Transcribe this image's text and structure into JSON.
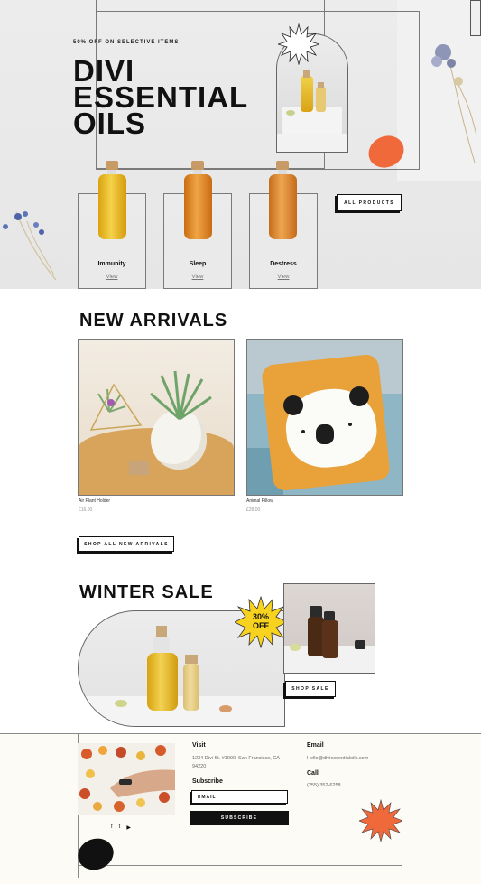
{
  "hero": {
    "eyebrow": "50% OFF ON SELECTIVE ITEMS",
    "title_line1": "DIVI",
    "title_line2": "ESSENTIAL",
    "title_line3": "OILS",
    "all_products_label": "ALL PRODUCTS",
    "accent": "#f0693a"
  },
  "products": [
    {
      "name": "Immunity",
      "link": "View",
      "liquid": "#e8b418"
    },
    {
      "name": "Sleep",
      "link": "View",
      "liquid": "#e0892a"
    },
    {
      "name": "Destress",
      "link": "View",
      "liquid": "#de8a30"
    }
  ],
  "new_arrivals": {
    "title": "NEW ARRIVALS",
    "items": [
      {
        "name": "Air Plant Holder",
        "price": "£16.00"
      },
      {
        "name": "Animal Pillow",
        "price": "£28.00"
      }
    ],
    "shop_all_label": "SHOP ALL NEW ARRIVALS"
  },
  "winter_sale": {
    "title": "WINTER SALE",
    "badge_line1": "30%",
    "badge_line2": "OFF",
    "shop_sale_label": "SHOP SALE",
    "badge_color": "#f7d21e"
  },
  "footer": {
    "visit_heading": "Visit",
    "address_line1": "1234 Divi St. #1000, San Francisco, CA",
    "address_line2": "94220",
    "email_heading": "Email",
    "email_value": "Hello@diviessentialoils.com",
    "call_heading": "Call",
    "phone_value": "(255) 352-6258",
    "subscribe_heading": "Subscribe",
    "email_placeholder": "EMAIL",
    "subscribe_button": "SUBSCRIBE",
    "social_icons": [
      "facebook-icon",
      "twitter-icon",
      "youtube-icon"
    ],
    "social_glyphs": [
      "f",
      "t",
      "▶"
    ]
  }
}
